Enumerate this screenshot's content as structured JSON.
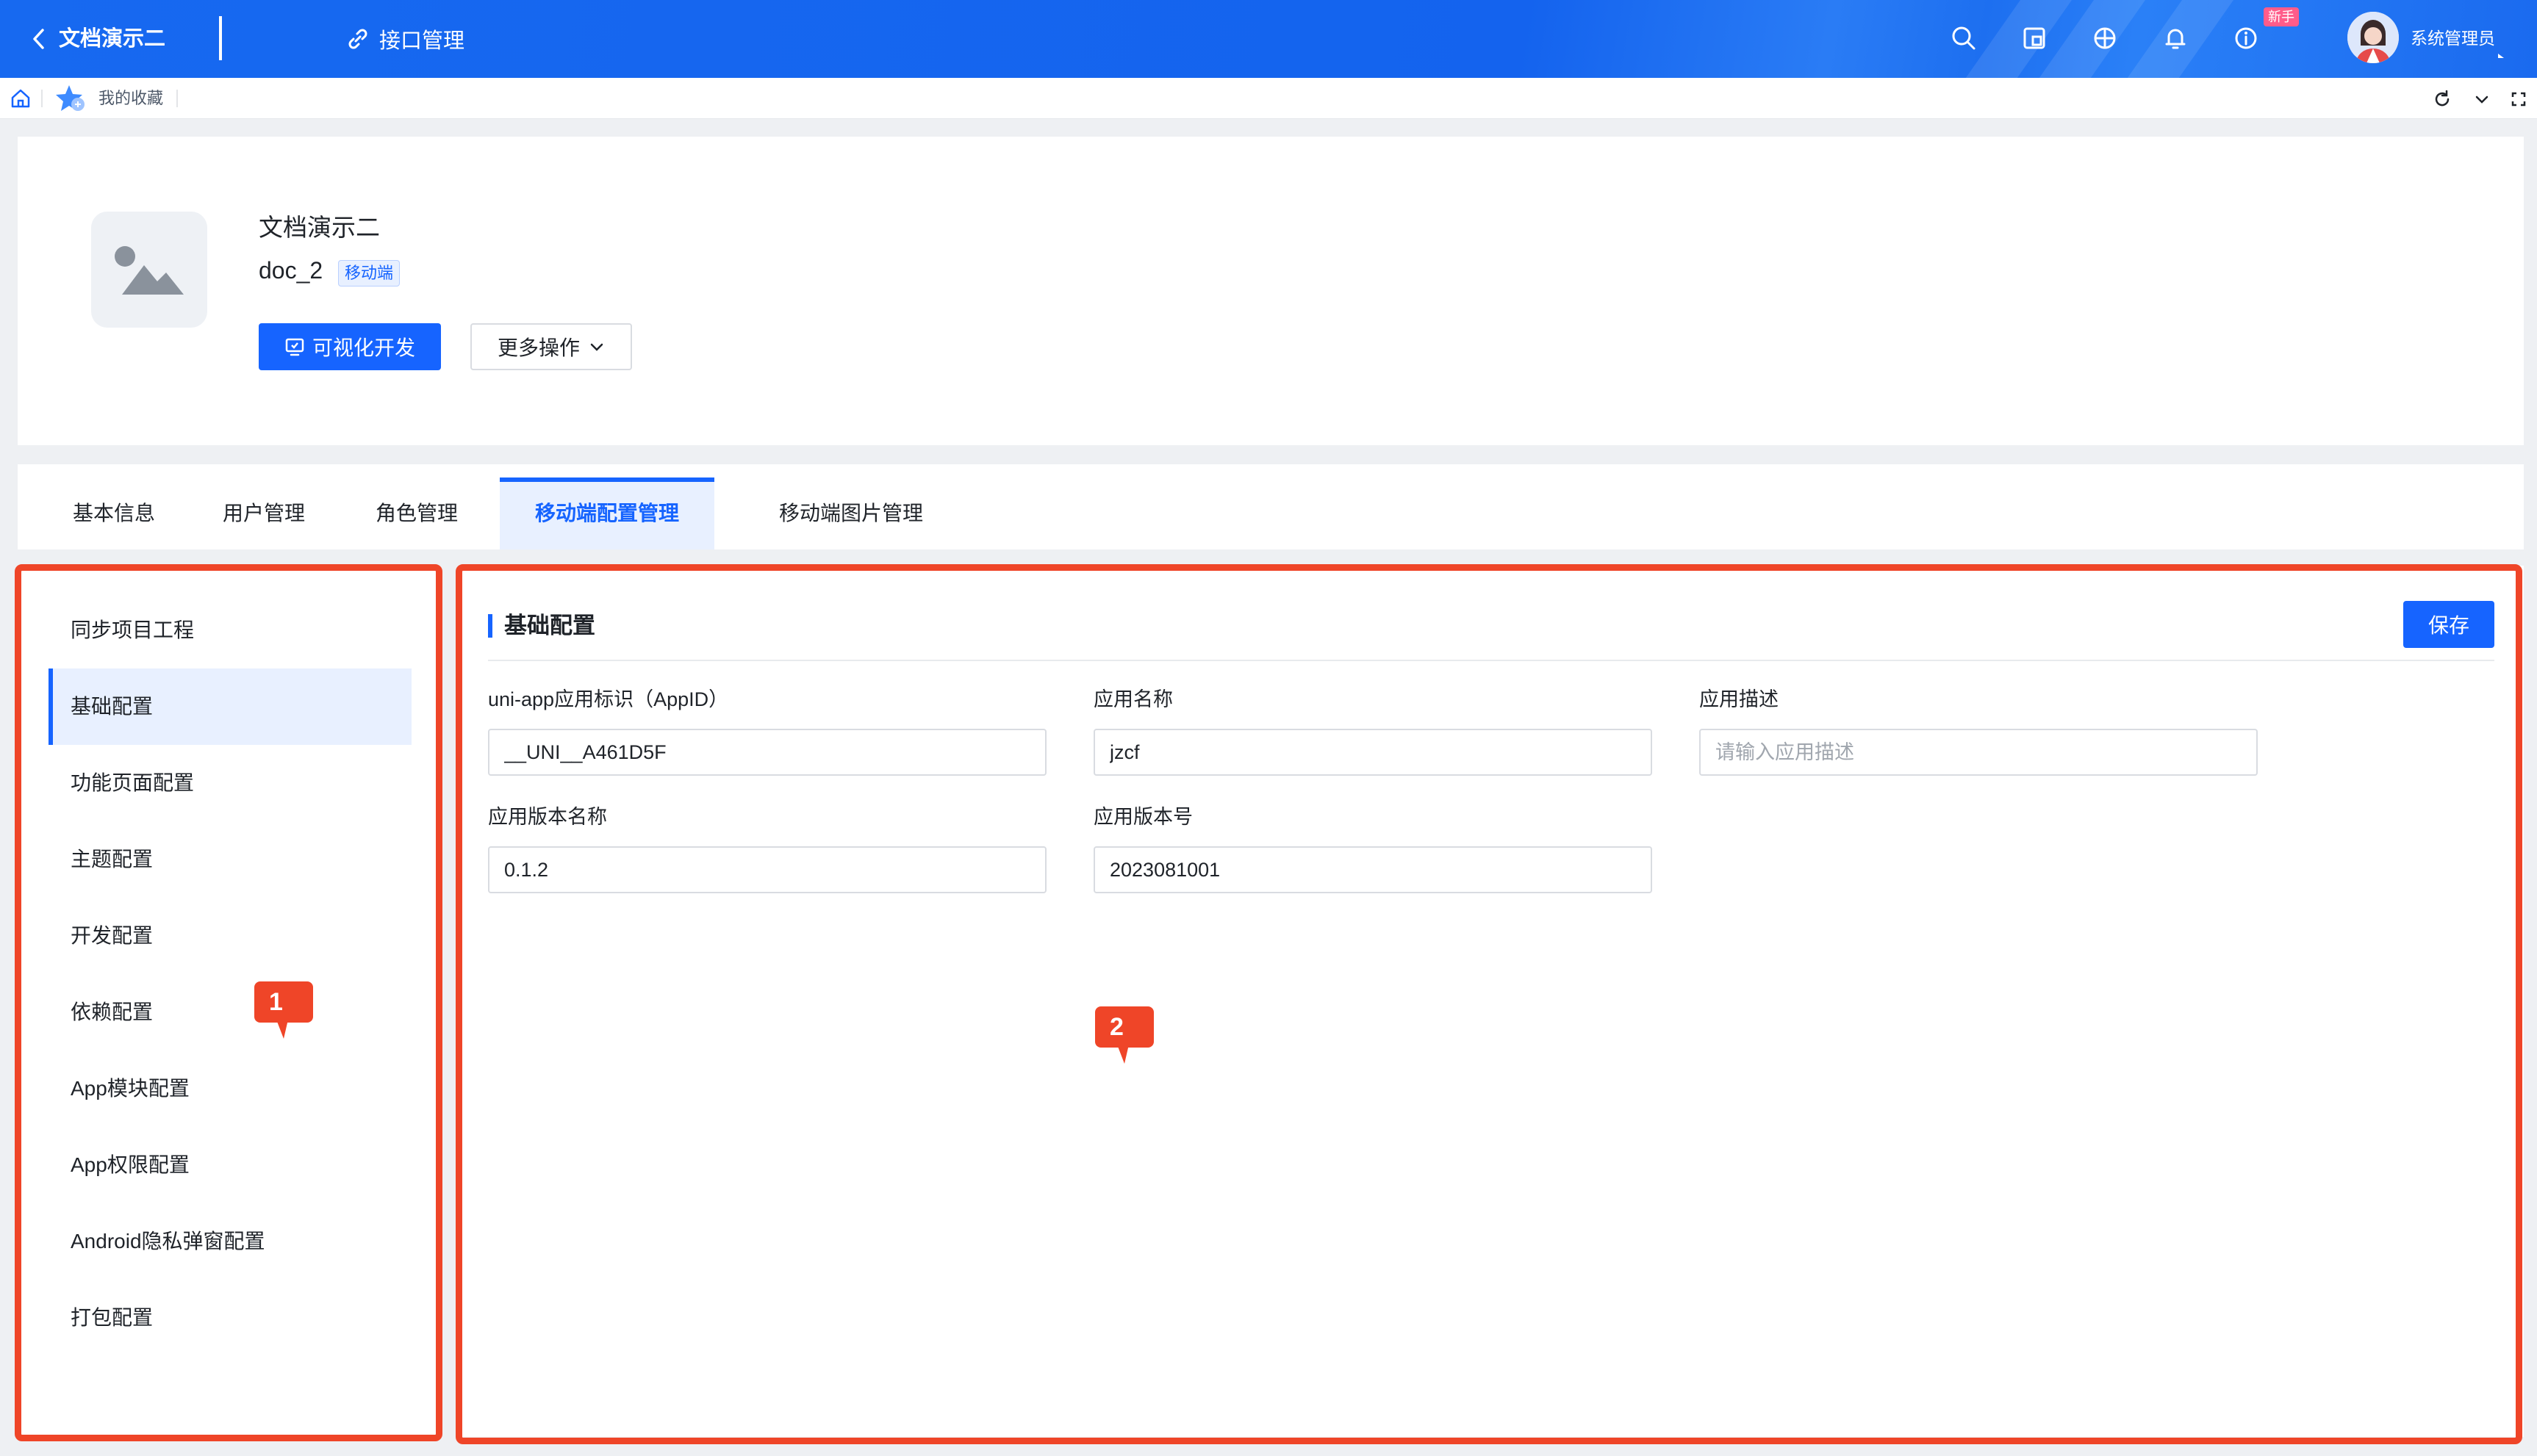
{
  "header": {
    "app_title": "文档演示二",
    "api_link": "接口管理",
    "new_badge": "新手",
    "user_name": "系统管理员",
    "icons": [
      "search-icon",
      "window-icon",
      "globe-icon",
      "bell-icon",
      "info-icon"
    ]
  },
  "tabstrip": {
    "favorites_label": "我的收藏"
  },
  "app_info": {
    "name": "文档演示二",
    "code": "doc_2",
    "tag": "移动端",
    "visual_dev_button": "可视化开发",
    "more_actions_button": "更多操作"
  },
  "main_tabs": [
    {
      "label": "基本信息",
      "active": false
    },
    {
      "label": "用户管理",
      "active": false
    },
    {
      "label": "角色管理",
      "active": false
    },
    {
      "label": "移动端配置管理",
      "active": true
    },
    {
      "label": "移动端图片管理",
      "active": false
    }
  ],
  "side_menu": [
    {
      "label": "同步项目工程",
      "active": false
    },
    {
      "label": "基础配置",
      "active": true
    },
    {
      "label": "功能页面配置",
      "active": false
    },
    {
      "label": "主题配置",
      "active": false
    },
    {
      "label": "开发配置",
      "active": false
    },
    {
      "label": "依赖配置",
      "active": false
    },
    {
      "label": "App模块配置",
      "active": false
    },
    {
      "label": "App权限配置",
      "active": false
    },
    {
      "label": "Android隐私弹窗配置",
      "active": false
    },
    {
      "label": "打包配置",
      "active": false
    }
  ],
  "content": {
    "section_title": "基础配置",
    "save_button": "保存",
    "fields": [
      {
        "label": "uni-app应用标识（AppID）",
        "value": "__UNI__A461D5F",
        "placeholder": ""
      },
      {
        "label": "应用名称",
        "value": "jzcf",
        "placeholder": ""
      },
      {
        "label": "应用描述",
        "value": "",
        "placeholder": "请输入应用描述"
      },
      {
        "label": "应用版本名称",
        "value": "0.1.2",
        "placeholder": ""
      },
      {
        "label": "应用版本号",
        "value": "2023081001",
        "placeholder": ""
      }
    ]
  },
  "annotations": {
    "marker_1": "1",
    "marker_2": "2"
  },
  "colors": {
    "primary": "#1664ff",
    "header_bg": "#1769f0",
    "annotation": "#ef4528"
  }
}
